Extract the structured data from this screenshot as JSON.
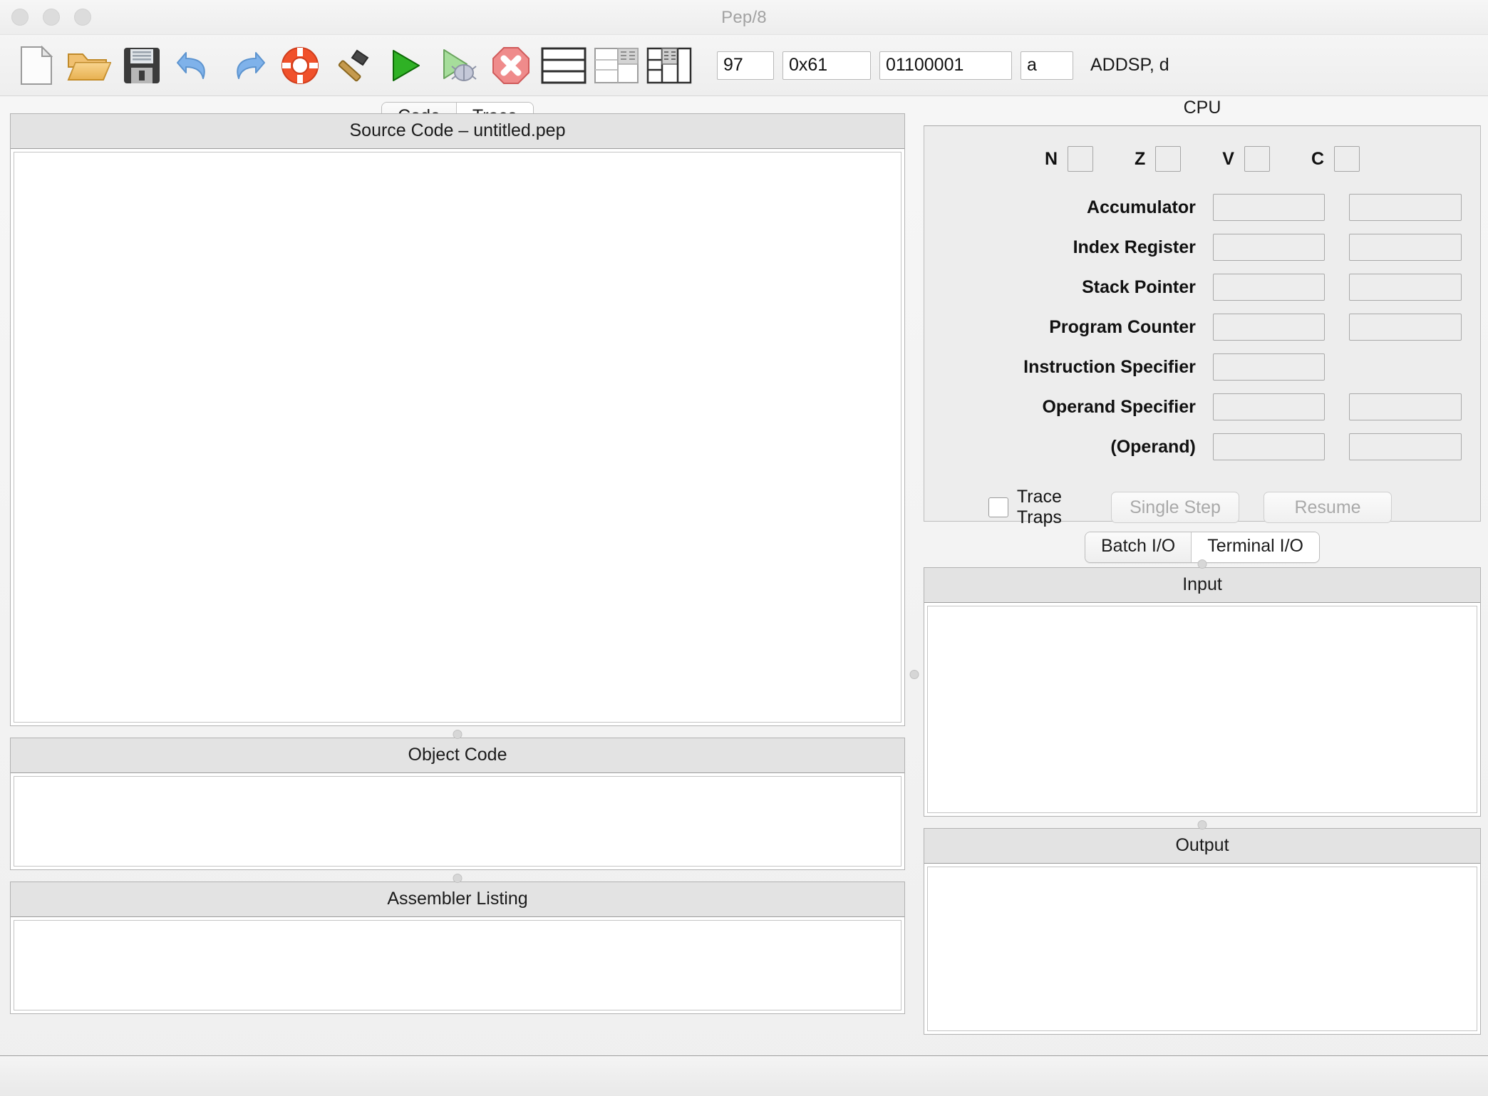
{
  "window": {
    "title": "Pep/8",
    "traffic_lights": [
      "close-button",
      "minimize-button",
      "zoom-button"
    ]
  },
  "toolbar": {
    "buttons": [
      {
        "name": "new-file-icon",
        "label": "New"
      },
      {
        "name": "open-folder-icon",
        "label": "Open"
      },
      {
        "name": "save-floppy-icon",
        "label": "Save"
      },
      {
        "name": "undo-arrow-icon",
        "label": "Undo"
      },
      {
        "name": "redo-arrow-icon",
        "label": "Redo"
      },
      {
        "name": "lifesaver-icon",
        "label": "Help"
      },
      {
        "name": "hammer-icon",
        "label": "Assemble"
      },
      {
        "name": "run-play-icon",
        "label": "Run"
      },
      {
        "name": "debug-play-bug-icon",
        "label": "Start Debugging"
      },
      {
        "name": "stop-debugging-icon",
        "label": "Stop Debugging"
      },
      {
        "name": "layout-rows-icon",
        "label": "Code Only View"
      },
      {
        "name": "layout-code-cpu-icon",
        "label": "Code/CPU View"
      },
      {
        "name": "layout-code-cpu-memory-icon",
        "label": "Code/CPU/Memory View"
      }
    ],
    "byte_converter": {
      "decimal": "97",
      "hex": "0x61",
      "binary": "01100001",
      "character": "a",
      "mnemonic": "ADDSP, d"
    }
  },
  "code_tabs": {
    "items": [
      {
        "label": "Code",
        "active": false
      },
      {
        "label": "Trace",
        "active": true
      }
    ]
  },
  "panes": {
    "source_code": {
      "title": "Source Code – untitled.pep",
      "content": ""
    },
    "object_code": {
      "title": "Object Code",
      "content": ""
    },
    "assembler_listing": {
      "title": "Assembler Listing",
      "content": ""
    },
    "input": {
      "title": "Input",
      "content": ""
    },
    "output": {
      "title": "Output",
      "content": ""
    }
  },
  "cpu": {
    "title": "CPU",
    "flags": [
      {
        "label": "N",
        "value": ""
      },
      {
        "label": "Z",
        "value": ""
      },
      {
        "label": "V",
        "value": ""
      },
      {
        "label": "C",
        "value": ""
      }
    ],
    "registers": [
      {
        "label": "Accumulator",
        "hex": "",
        "dec": "",
        "has_second": true
      },
      {
        "label": "Index Register",
        "hex": "",
        "dec": "",
        "has_second": true
      },
      {
        "label": "Stack Pointer",
        "hex": "",
        "dec": "",
        "has_second": true
      },
      {
        "label": "Program Counter",
        "hex": "",
        "dec": "",
        "has_second": true
      },
      {
        "label": "Instruction Specifier",
        "hex": "",
        "dec": "",
        "has_second": false
      },
      {
        "label": "Operand Specifier",
        "hex": "",
        "dec": "",
        "has_second": true
      },
      {
        "label": "(Operand)",
        "hex": "",
        "dec": "",
        "has_second": true
      }
    ],
    "trace_traps": {
      "label": "Trace Traps",
      "checked": false
    },
    "single_step": {
      "label": "Single Step",
      "enabled": false
    },
    "resume": {
      "label": "Resume",
      "enabled": false
    }
  },
  "io_tabs": {
    "items": [
      {
        "label": "Batch I/O",
        "active": false
      },
      {
        "label": "Terminal I/O",
        "active": true
      }
    ]
  },
  "statusbar": {
    "text": ""
  },
  "colors": {
    "window_bg": "#efefef",
    "panel_header": "#e3e3e3",
    "panel_body": "#ffffff",
    "cpu_bg": "#ededed",
    "border": "#b2b2b2",
    "title_text": "#a2a2a2",
    "disabled_text": "#a9a9a9"
  }
}
